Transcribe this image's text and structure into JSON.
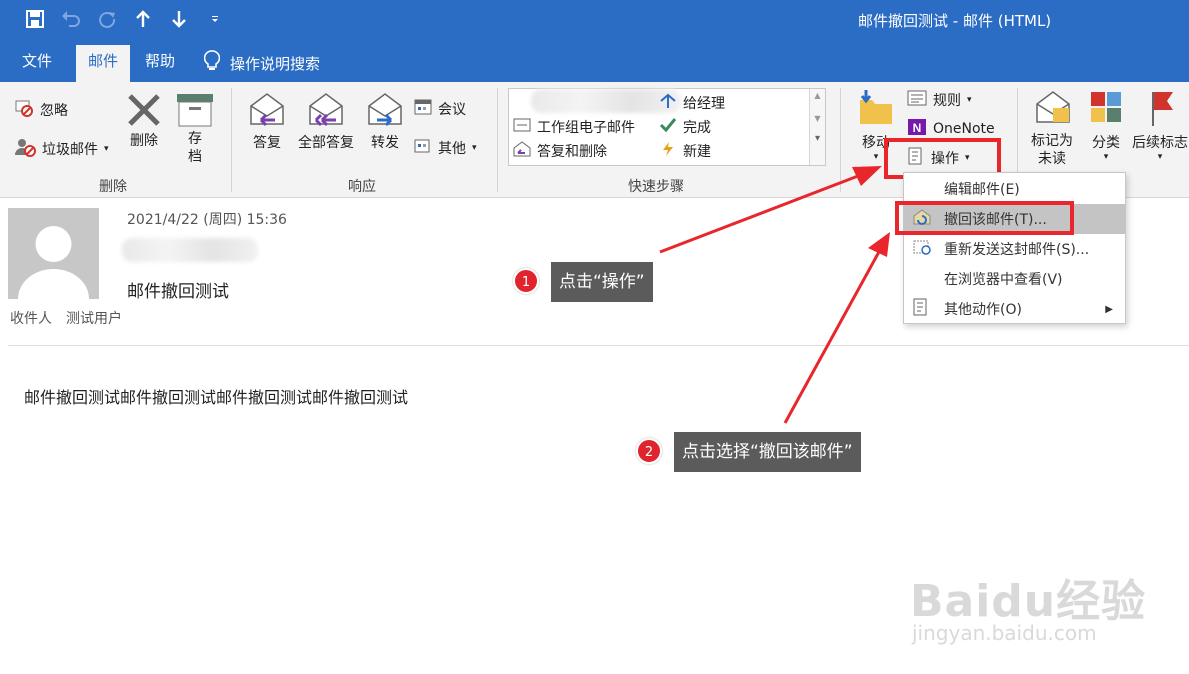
{
  "window": {
    "title": "邮件撤回测试  -  邮件 (HTML)"
  },
  "qat": {
    "icons": [
      "save-icon",
      "undo-icon",
      "redo-icon",
      "up-arrow-icon",
      "down-arrow-icon",
      "customize-qat-icon"
    ]
  },
  "tabs": {
    "file": "文件",
    "mail": "邮件",
    "help": "帮助",
    "tell_me": "操作说明搜索"
  },
  "ribbon": {
    "delete_group": {
      "ignore": "忽略",
      "junk": "垃圾邮件",
      "delete": "删除",
      "archive": "存档",
      "label": "删除"
    },
    "respond_group": {
      "reply": "答复",
      "reply_all": "全部答复",
      "forward": "转发",
      "meeting": "会议",
      "more": "其他",
      "label": "响应"
    },
    "quick_steps": {
      "team_email": "工作组电子邮件",
      "reply_delete": "答复和删除",
      "to_manager": "给经理",
      "done": "完成",
      "create_new": "新建",
      "label": "快速步骤"
    },
    "move_group": {
      "move": "移动",
      "rules": "规则",
      "onenote": "OneNote",
      "actions": "操作"
    },
    "tags_group": {
      "mark_unread": "标记为未读",
      "categorize": "分类",
      "follow_up": "后续标志"
    }
  },
  "actions_menu": {
    "items": [
      {
        "label": "编辑邮件(E)"
      },
      {
        "label": "撤回该邮件(T)..."
      },
      {
        "label": "重新发送这封邮件(S)..."
      },
      {
        "label": "在浏览器中查看(V)"
      },
      {
        "label": "其他动作(O)"
      }
    ]
  },
  "message": {
    "date": "2021/4/22 (周四) 15:36",
    "subject": "邮件撤回测试",
    "to_label": "收件人",
    "to_value": "测试用户",
    "body": "邮件撤回测试邮件撤回测试邮件撤回测试邮件撤回测试"
  },
  "callouts": [
    {
      "number": "1",
      "text": "点击“操作”"
    },
    {
      "number": "2",
      "text": "点击选择“撤回该邮件”"
    }
  ],
  "watermark": {
    "brand": "Baidu经验",
    "url": "jingyan.baidu.com"
  },
  "colors": {
    "title_bar": "#2b6cc4",
    "ribbon_bg": "#f3f3f3",
    "highlight_red": "#e8262b",
    "callout_bg": "#5b5b5b",
    "menu_hover": "#c4c4c4"
  }
}
